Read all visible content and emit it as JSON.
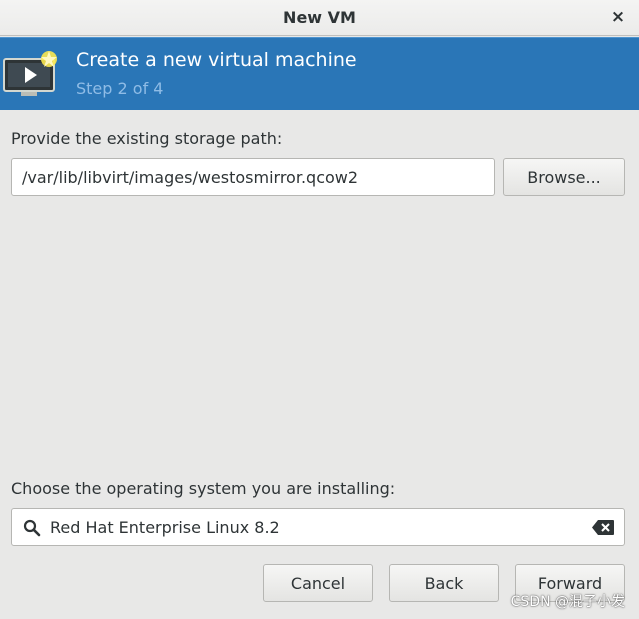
{
  "window": {
    "title": "New VM",
    "close_glyph": "×"
  },
  "banner": {
    "heading": "Create a new virtual machine",
    "step": "Step 2 of 4",
    "icon": "vm-monitor-new-icon"
  },
  "storage": {
    "label": "Provide the existing storage path:",
    "path_value": "/var/lib/libvirt/images/westosmirror.qcow2",
    "browse_label": "Browse..."
  },
  "os": {
    "label": "Choose the operating system you are installing:",
    "search_value": "Red Hat Enterprise Linux 8.2",
    "search_icon": "search-icon",
    "clear_icon": "clear-text-icon"
  },
  "footer": {
    "cancel_label": "Cancel",
    "back_label": "Back",
    "forward_label": "Forward"
  },
  "watermark": "CSDN @混子小发",
  "colors": {
    "banner_bg": "#2a76b7",
    "step_text": "#8fbce6",
    "window_bg": "#e8e8e7"
  }
}
